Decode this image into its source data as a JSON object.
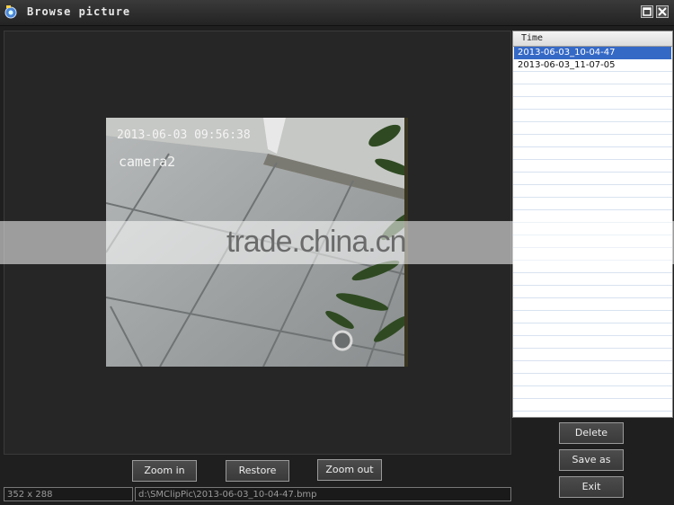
{
  "window": {
    "title": "Browse picture"
  },
  "preview": {
    "timestamp": "2013-06-03 09:56:38",
    "camera": "camera2"
  },
  "list": {
    "header": "Time",
    "items": [
      {
        "label": "2013-06-03_10-04-47",
        "selected": true
      },
      {
        "label": "2013-06-03_11-07-05",
        "selected": false
      }
    ]
  },
  "buttons": {
    "zoom_in": "Zoom in",
    "restore": "Restore",
    "zoom_out": "Zoom out",
    "delete": "Delete",
    "save_as": "Save as",
    "exit": "Exit"
  },
  "status": {
    "size": "352 x 288",
    "path": "d:\\SMClipPic\\2013-06-03_10-04-47.bmp"
  },
  "watermark": "trade.china.cn",
  "icons": {
    "app": "camera-app-icon",
    "maximize": "maximize-icon",
    "close": "close-icon"
  },
  "colors": {
    "selection": "#3569c6",
    "background": "#1f1f1f"
  }
}
